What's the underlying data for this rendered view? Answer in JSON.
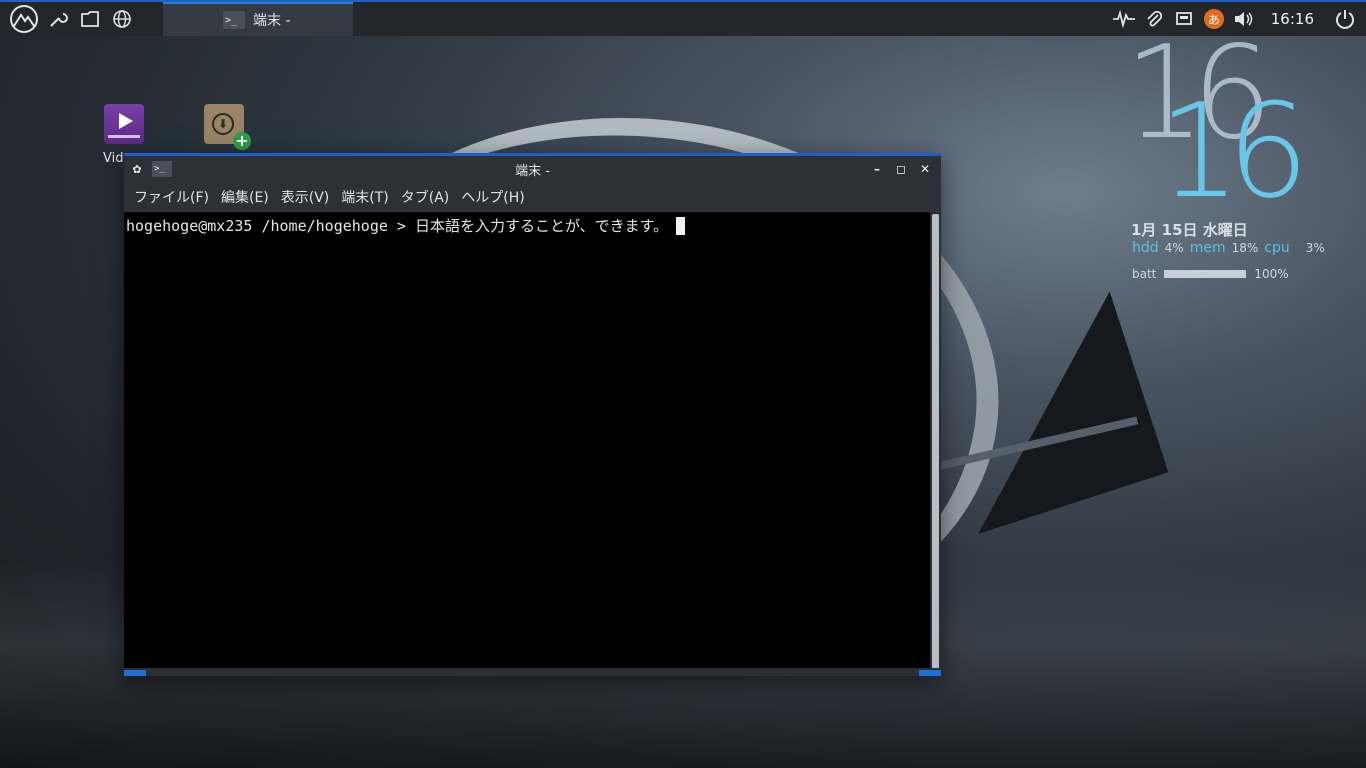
{
  "panel": {
    "task_label": "端末 -",
    "clock": "16:16",
    "ime_label": "あ"
  },
  "desktop": {
    "video_label": "Vid"
  },
  "conky": {
    "hour": "16",
    "minute": "16",
    "date": "1月 15日 水曜日",
    "hdd_label": "hdd",
    "hdd_value": "4%",
    "mem_label": "mem",
    "mem_value": "18%",
    "cpu_label": "cpu",
    "cpu_value": "3%",
    "batt_label": "batt",
    "batt_value": "100%",
    "batt_fraction": 1.0
  },
  "terminal": {
    "title": "端末 -",
    "menu": [
      "ファイル(F)",
      "編集(E)",
      "表示(V)",
      "端末(T)",
      "タブ(A)",
      "ヘルプ(H)"
    ],
    "line": "hogehoge@mx235 /home/hogehoge > 日本語を入力することが、できます。"
  },
  "colors": {
    "accent": "#1e5fc8",
    "clock_accent": "#68c6e6",
    "ime": "#e36b1d"
  }
}
